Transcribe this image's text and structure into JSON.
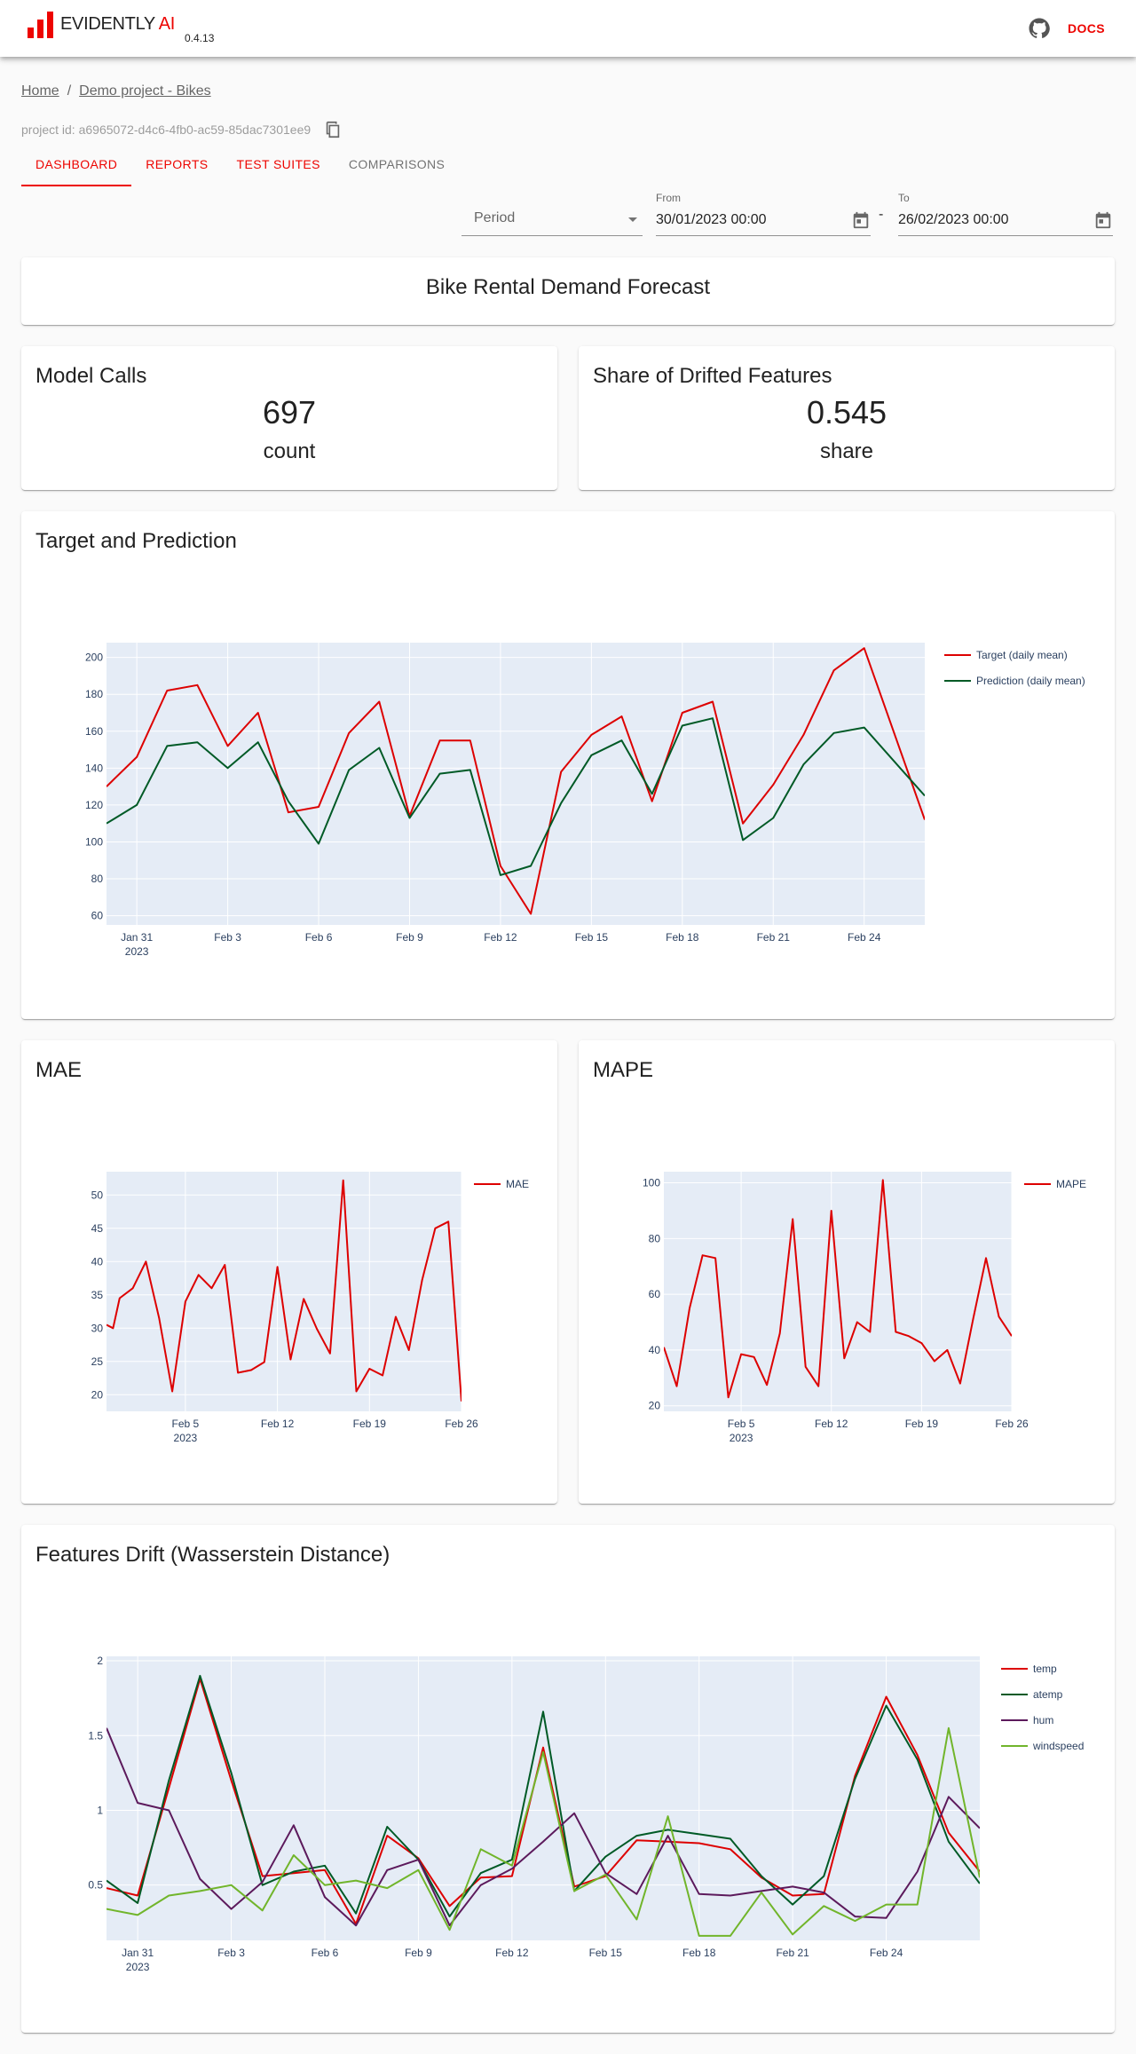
{
  "app": {
    "logo_text_main": "EVIDENTLY",
    "logo_text_accent": " AI",
    "version": "0.4.13",
    "docs_label": "DOCS",
    "icons": {
      "github": "github-icon",
      "copy": "copy-icon",
      "calendar": "calendar-icon"
    }
  },
  "breadcrumb": {
    "home": "Home",
    "separator": "/",
    "project": "Demo project - Bikes"
  },
  "project_id": "project id: a6965072-d4c6-4fb0-ac59-85dac7301ee9",
  "tabs": [
    {
      "label": "DASHBOARD"
    },
    {
      "label": "REPORTS"
    },
    {
      "label": "TEST SUITES"
    },
    {
      "label": "COMPARISONS"
    }
  ],
  "filters": {
    "period": "Period",
    "from_label": "From",
    "from_value": "30/01/2023 00:00",
    "separator": "-",
    "to_label": "To",
    "to_value": "26/02/2023 00:00"
  },
  "dashboard_title": "Bike Rental Demand Forecast",
  "counters": [
    {
      "title": "Model Calls",
      "value": "697",
      "label": "count"
    },
    {
      "title": "Share of Drifted Features",
      "value": "0.545",
      "label": "share"
    }
  ],
  "colors": {
    "accent": "#ed0400",
    "plot_bg": "#e5ecf6",
    "red": "#dd0000",
    "dark_green": "#005a26",
    "purple": "#5c1a5c",
    "light_green": "#71b52b"
  },
  "chart_data": [
    {
      "id": "target_prediction",
      "title": "Target and Prediction",
      "type": "line",
      "x_ticks": [
        "Jan 31\n2023",
        "Feb 3",
        "Feb 6",
        "Feb 9",
        "Feb 12",
        "Feb 15",
        "Feb 18",
        "Feb 21",
        "Feb 24"
      ],
      "x_tick_days": [
        1,
        4,
        7,
        10,
        13,
        16,
        19,
        22,
        25
      ],
      "xlim": [
        0,
        27
      ],
      "ylim": [
        55,
        208
      ],
      "y_ticks": [
        60,
        80,
        100,
        120,
        140,
        160,
        180,
        200
      ],
      "legend_position": "right",
      "x": [
        0,
        1,
        2,
        3,
        4,
        5,
        6,
        7,
        8,
        9,
        10,
        11,
        12,
        13,
        14,
        15,
        16,
        17,
        18,
        19,
        20,
        21,
        22,
        23,
        24,
        25,
        27
      ],
      "series": [
        {
          "name": "Target (daily mean)",
          "color": "#dd0000",
          "values": [
            130,
            146,
            182,
            185,
            152,
            170,
            116,
            119,
            159,
            176,
            114,
            155,
            155,
            87,
            61,
            138,
            158,
            168,
            122,
            170,
            176,
            110,
            131,
            158,
            193,
            205,
            112
          ]
        },
        {
          "name": "Prediction (daily mean)",
          "color": "#005a26",
          "values": [
            110,
            120,
            152,
            154,
            140,
            154,
            122,
            99,
            139,
            151,
            113,
            137,
            139,
            82,
            87,
            121,
            147,
            155,
            126,
            163,
            167,
            101,
            113,
            142,
            159,
            162,
            125
          ]
        }
      ]
    },
    {
      "id": "mae",
      "title": "MAE",
      "type": "line",
      "x_ticks": [
        "Feb 5\n2023",
        "Feb 12",
        "Feb 19",
        "Feb 26"
      ],
      "x_tick_days": [
        6,
        13,
        20,
        27
      ],
      "xlim": [
        0,
        27
      ],
      "ylim": [
        17.5,
        53.5
      ],
      "y_ticks": [
        20,
        25,
        30,
        35,
        40,
        45,
        50
      ],
      "legend_position": "right",
      "x": [
        0,
        0.5,
        1,
        2,
        3,
        4,
        5,
        6,
        7,
        8,
        9,
        10,
        11,
        12,
        13,
        14,
        15,
        16,
        17,
        18,
        19,
        20,
        21,
        22,
        23,
        24,
        25,
        26,
        27
      ],
      "series": [
        {
          "name": "MAE",
          "color": "#dd0000",
          "values": [
            30.5,
            30,
            34.5,
            36,
            40,
            31.5,
            20.5,
            34,
            38,
            36,
            39.5,
            23.3,
            23.7,
            24.9,
            39.2,
            25.3,
            34.4,
            29.9,
            26.2,
            52.2,
            20.5,
            23.9,
            22.9,
            31.7,
            26.7,
            37.2,
            45,
            46,
            19
          ]
        }
      ]
    },
    {
      "id": "mape",
      "title": "MAPE",
      "type": "line",
      "x_ticks": [
        "Feb 5\n2023",
        "Feb 12",
        "Feb 19",
        "Feb 26"
      ],
      "x_tick_days": [
        6,
        13,
        20,
        27
      ],
      "xlim": [
        0,
        27
      ],
      "ylim": [
        18,
        104
      ],
      "y_ticks": [
        20,
        40,
        60,
        80,
        100
      ],
      "legend_position": "right",
      "x": [
        0,
        1,
        2,
        3,
        4,
        5,
        6,
        7,
        8,
        9,
        10,
        11,
        12,
        13,
        14,
        15,
        16,
        17,
        18,
        19,
        20,
        21,
        22,
        23,
        24,
        25,
        26,
        27
      ],
      "series": [
        {
          "name": "MAPE",
          "color": "#dd0000",
          "values": [
            41,
            27,
            55,
            74,
            73,
            23,
            38.5,
            37.5,
            27.5,
            46,
            87,
            34,
            27,
            90,
            37,
            50,
            46.5,
            101,
            46.5,
            45,
            42.5,
            36,
            40,
            28,
            51,
            73,
            52,
            45
          ]
        }
      ]
    },
    {
      "id": "features_drift",
      "title": "Features Drift (Wasserstein Distance)",
      "type": "line",
      "x_ticks": [
        "Jan 31\n2023",
        "Feb 3",
        "Feb 6",
        "Feb 9",
        "Feb 12",
        "Feb 15",
        "Feb 18",
        "Feb 21",
        "Feb 24"
      ],
      "x_tick_days": [
        1,
        4,
        7,
        10,
        13,
        16,
        19,
        22,
        25
      ],
      "xlim": [
        0,
        28
      ],
      "ylim": [
        0.13,
        2.03
      ],
      "y_ticks": [
        0.5,
        1,
        1.5,
        2
      ],
      "y_tick_labels": [
        "0.5",
        "1",
        "1.5",
        "2"
      ],
      "legend_position": "right",
      "x": [
        0,
        1,
        2,
        3,
        4,
        5,
        6,
        7,
        8,
        9,
        10,
        11,
        12,
        13,
        14,
        15,
        16,
        17,
        18,
        19,
        20,
        21,
        22,
        23,
        24,
        25,
        26,
        27,
        28
      ],
      "series": [
        {
          "name": "temp",
          "color": "#dd0000",
          "values": [
            0.48,
            0.43,
            1.15,
            1.88,
            1.2,
            0.56,
            0.58,
            0.6,
            0.24,
            0.83,
            0.68,
            0.36,
            0.55,
            0.56,
            1.42,
            0.49,
            0.56,
            0.8,
            0.79,
            0.78,
            0.74,
            0.55,
            0.43,
            0.44,
            1.23,
            1.76,
            1.37,
            0.85,
            0.59
          ]
        },
        {
          "name": "atemp",
          "color": "#005a26",
          "values": [
            0.53,
            0.38,
            1.2,
            1.9,
            1.25,
            0.5,
            0.59,
            0.63,
            0.31,
            0.89,
            0.67,
            0.29,
            0.58,
            0.67,
            1.66,
            0.46,
            0.69,
            0.83,
            0.87,
            0.84,
            0.81,
            0.56,
            0.37,
            0.56,
            1.21,
            1.7,
            1.34,
            0.79,
            0.51
          ]
        },
        {
          "name": "hum",
          "color": "#5c1a5c",
          "values": [
            1.55,
            1.05,
            1.0,
            0.54,
            0.34,
            0.52,
            0.9,
            0.42,
            0.23,
            0.6,
            0.67,
            0.23,
            0.5,
            0.61,
            0.79,
            0.98,
            0.58,
            0.44,
            0.83,
            0.44,
            0.43,
            0.46,
            0.49,
            0.45,
            0.29,
            0.28,
            0.59,
            1.09,
            0.88
          ]
        },
        {
          "name": "windspeed",
          "color": "#71b52b",
          "values": [
            0.34,
            0.3,
            0.43,
            0.46,
            0.5,
            0.33,
            0.7,
            0.5,
            0.53,
            0.48,
            0.6,
            0.2,
            0.74,
            0.63,
            1.39,
            0.46,
            0.57,
            0.27,
            0.96,
            0.16,
            0.16,
            0.45,
            0.17,
            0.36,
            0.26,
            0.37,
            0.37,
            1.55,
            0.55
          ]
        }
      ]
    }
  ]
}
